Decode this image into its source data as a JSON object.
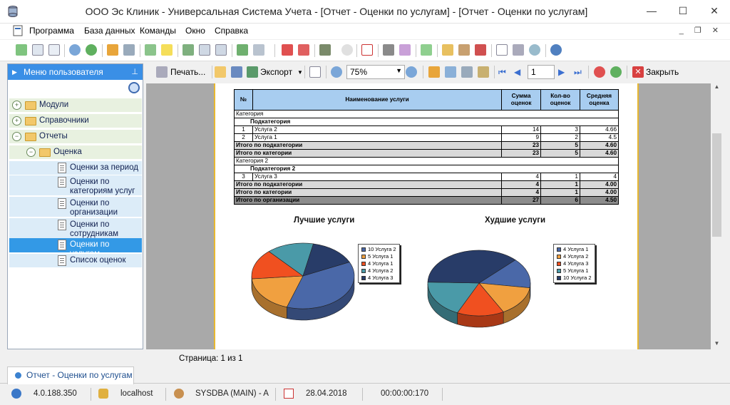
{
  "window": {
    "title": "ООО Эс Клиник - Универсальная Система Учета - [Отчет - Оценки по услугам] - [Отчет - Оценки по услугам]",
    "minimize": "—",
    "maximize": "☐",
    "close": "✕"
  },
  "menu": {
    "items": [
      "Программа",
      "База данных",
      "Команды",
      "Окно",
      "Справка"
    ],
    "mdi_buttons": "_ ❐ ✕"
  },
  "sidebar": {
    "header": "Меню пользователя",
    "pin": "📌",
    "tree": [
      {
        "label": "Модули",
        "level": 0,
        "type": "folder",
        "expander": "+"
      },
      {
        "label": "Справочники",
        "level": 0,
        "type": "folder",
        "expander": "+"
      },
      {
        "label": "Отчеты",
        "level": 0,
        "type": "folder",
        "expander": "−"
      },
      {
        "label": "Оценка",
        "level": 1,
        "type": "folder",
        "expander": "−"
      },
      {
        "label": "Оценки за период",
        "level": 2,
        "type": "doc"
      },
      {
        "label": "Оценки по категориям услуг",
        "level": 2,
        "type": "doc"
      },
      {
        "label": "Оценки по организации",
        "level": 2,
        "type": "doc"
      },
      {
        "label": "Оценки по сотрудникам",
        "level": 2,
        "type": "doc"
      },
      {
        "label": "Оценки по услугам",
        "level": 2,
        "type": "doc",
        "selected": true
      },
      {
        "label": "Список оценок",
        "level": 2,
        "type": "doc"
      }
    ]
  },
  "report_toolbar": {
    "print": "Печать...",
    "export": "Экспорт",
    "zoom": "75%",
    "page": "1",
    "close": "Закрыть"
  },
  "report": {
    "headers": [
      "№",
      "Наименование услуги",
      "Сумма оценок",
      "Кол-во оценок",
      "Средняя оценка"
    ],
    "rows": [
      {
        "kind": "cat",
        "label": "Категория"
      },
      {
        "kind": "subcat",
        "label": "Подкатегория"
      },
      {
        "kind": "data",
        "n": "1",
        "name": "Услуга 2",
        "sum": "14",
        "count": "3",
        "avg": "4.66"
      },
      {
        "kind": "data",
        "n": "2",
        "name": "Услуга 1",
        "sum": "9",
        "count": "2",
        "avg": "4.5"
      },
      {
        "kind": "sub",
        "label": "Итого по подкатегории",
        "sum": "23",
        "count": "5",
        "avg": "4.60"
      },
      {
        "kind": "sub",
        "label": "Итого по категории",
        "sum": "23",
        "count": "5",
        "avg": "4.60"
      },
      {
        "kind": "cat",
        "label": "Категория 2"
      },
      {
        "kind": "subcat",
        "label": "Подкатегория 2"
      },
      {
        "kind": "data",
        "n": "3",
        "name": "Услуга 3",
        "sum": "4",
        "count": "1",
        "avg": "4"
      },
      {
        "kind": "sub",
        "label": "Итого по подкатегории",
        "sum": "4",
        "count": "1",
        "avg": "4.00"
      },
      {
        "kind": "sub",
        "label": "Итого по категории",
        "sum": "4",
        "count": "1",
        "avg": "4.00"
      },
      {
        "kind": "tot",
        "label": "Итого по организации",
        "sum": "27",
        "count": "6",
        "avg": "4.50"
      }
    ]
  },
  "chart_data": [
    {
      "type": "pie",
      "title": "Лучшие услуги",
      "categories": [
        "10 Услуга 2",
        "5 Услуга 1",
        "4 Услуга 1",
        "4 Услуга 2",
        "4 Услуга 3"
      ],
      "values": [
        10,
        5,
        4,
        4,
        4
      ],
      "colors": [
        "#4a68a8",
        "#f0a040",
        "#f05020",
        "#4a9aa8",
        "#283c68"
      ],
      "legend": "top-right"
    },
    {
      "type": "pie",
      "title": "Худшие услуги",
      "categories": [
        "4 Услуга 1",
        "4 Услуга 2",
        "4 Услуга 3",
        "5 Услуга 1",
        "10 Услуга 2"
      ],
      "values": [
        4,
        4,
        4,
        5,
        10
      ],
      "colors": [
        "#4a68a8",
        "#f0a040",
        "#f05020",
        "#4a9aa8",
        "#283c68"
      ],
      "legend": "top-right"
    }
  ],
  "preview_status": "Страница: 1 из 1",
  "tab": {
    "label": "Отчет - Оценки по услугам"
  },
  "statusbar": {
    "version": "4.0.188.350",
    "server": "localhost",
    "user": "SYSDBA (MAIN) - A",
    "date": "28.04.2018",
    "time": "00:00:00:170"
  }
}
